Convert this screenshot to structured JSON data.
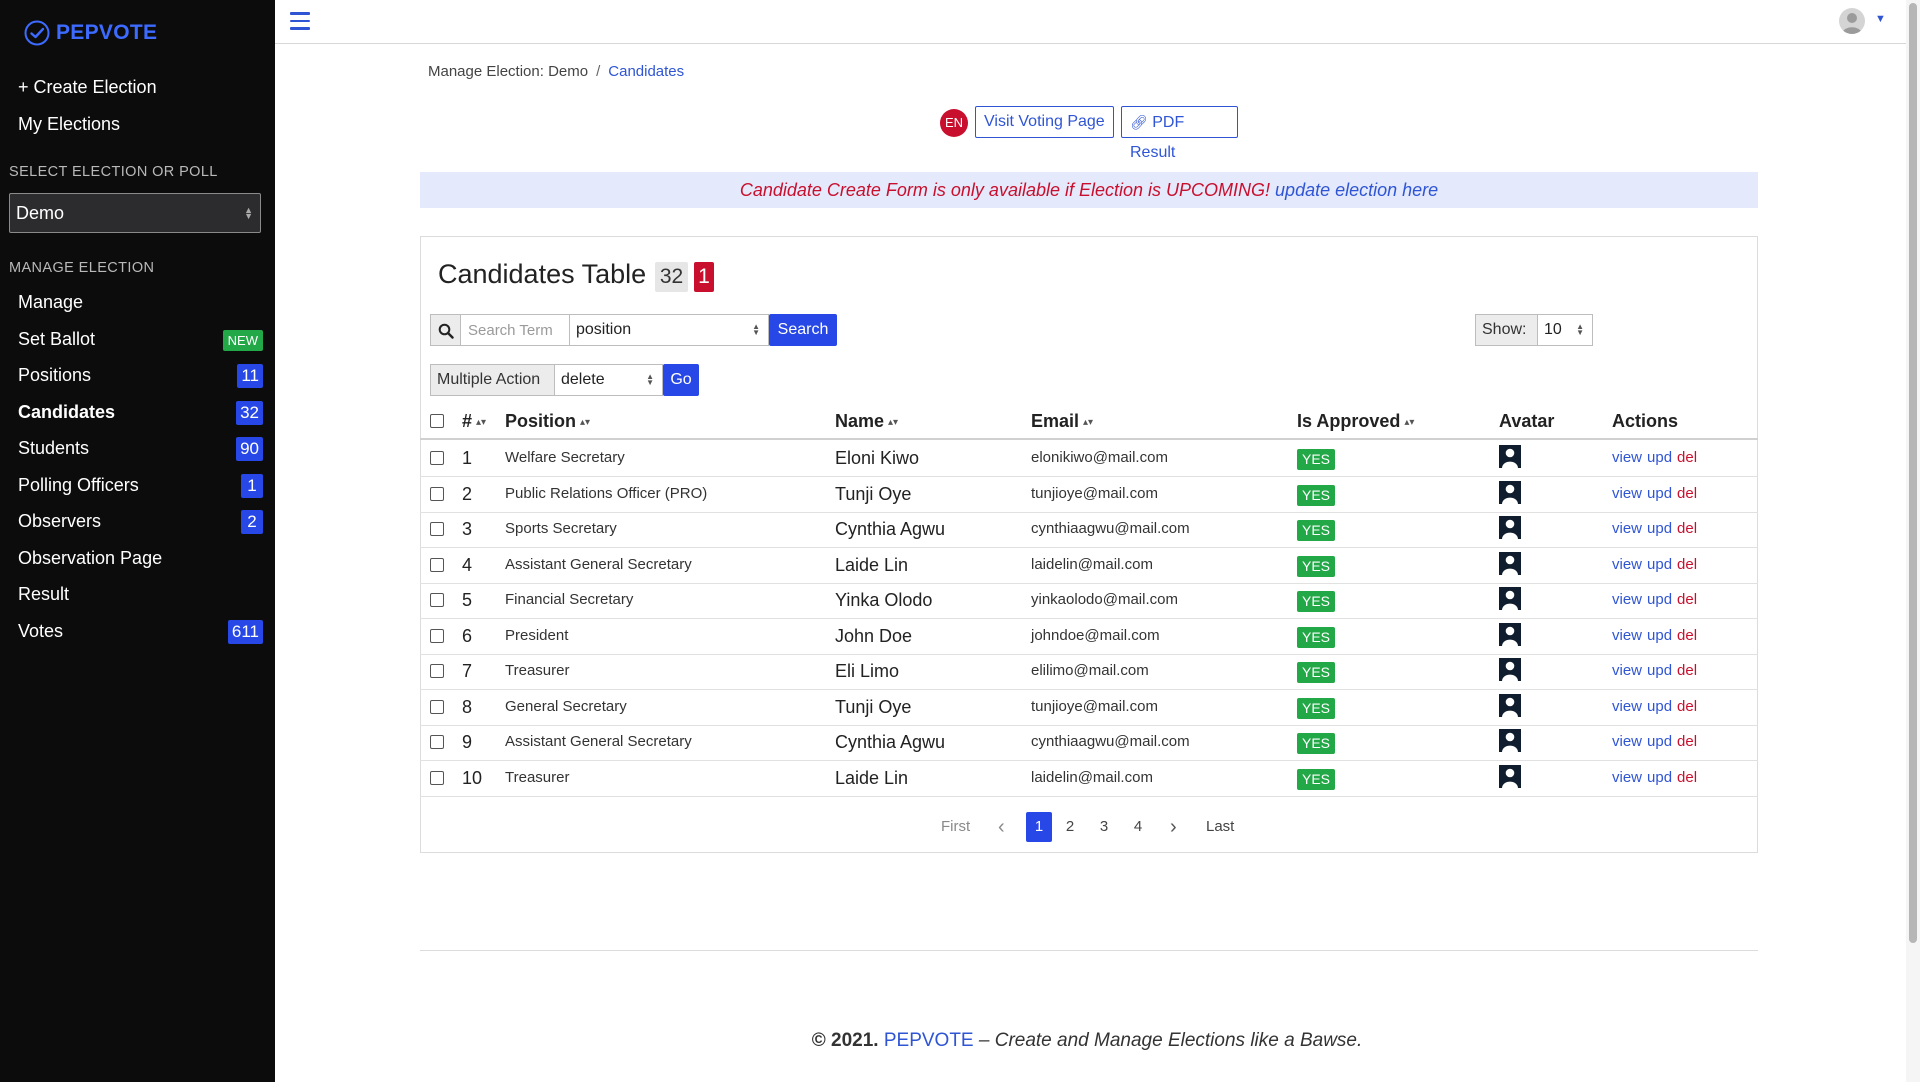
{
  "brand": {
    "name": "PEPVOTE"
  },
  "sidebar": {
    "create_election": "+ Create Election",
    "my_elections": "My Elections",
    "select_heading": "SELECT ELECTION OR POLL",
    "selected_election": "Demo",
    "manage_heading": "MANAGE ELECTION",
    "items": [
      {
        "label": "Manage",
        "badge": ""
      },
      {
        "label": "Set Ballot",
        "badge": "NEW"
      },
      {
        "label": "Positions",
        "badge": "11"
      },
      {
        "label": "Candidates",
        "badge": "32"
      },
      {
        "label": "Students",
        "badge": "90"
      },
      {
        "label": "Polling Officers",
        "badge": "1"
      },
      {
        "label": "Observers",
        "badge": "2"
      },
      {
        "label": "Observation Page",
        "badge": ""
      },
      {
        "label": "Result",
        "badge": ""
      },
      {
        "label": "Votes",
        "badge": "611"
      }
    ]
  },
  "breadcrumb": {
    "parent": "Manage Election: Demo",
    "separator": "/",
    "current": "Candidates"
  },
  "actions": {
    "lang": "EN",
    "visit_voting": "Visit Voting Page",
    "pdf_result": "PDF Result"
  },
  "notice": {
    "warning": "Candidate Create Form is only available if Election is UPCOMING!",
    "link": "update election here"
  },
  "table": {
    "title": "Candidates Table",
    "count_total": "32",
    "count_flag": "1",
    "search_placeholder": "Search Term",
    "search_field": "position",
    "search_button": "Search",
    "show_label": "Show:",
    "show_value": "10",
    "multi_action_label": "Multiple Action",
    "multi_action_value": "delete",
    "go_button": "Go",
    "columns": {
      "num": "#",
      "position": "Position",
      "name": "Name",
      "email": "Email",
      "approved": "Is Approved",
      "avatar": "Avatar",
      "actions": "Actions"
    },
    "action_labels": {
      "view": "view",
      "upd": "upd",
      "del": "del"
    },
    "rows": [
      {
        "num": "1",
        "position": "Welfare Secretary",
        "name": "Eloni Kiwo",
        "email": "elonikiwo@mail.com",
        "approved": "YES"
      },
      {
        "num": "2",
        "position": "Public Relations Officer (PRO)",
        "name": "Tunji Oye",
        "email": "tunjioye@mail.com",
        "approved": "YES"
      },
      {
        "num": "3",
        "position": "Sports Secretary",
        "name": "Cynthia Agwu",
        "email": "cynthiaagwu@mail.com",
        "approved": "YES"
      },
      {
        "num": "4",
        "position": "Assistant General Secretary",
        "name": "Laide Lin",
        "email": "laidelin@mail.com",
        "approved": "YES"
      },
      {
        "num": "5",
        "position": "Financial Secretary",
        "name": "Yinka Olodo",
        "email": "yinkaolodo@mail.com",
        "approved": "YES"
      },
      {
        "num": "6",
        "position": "President",
        "name": "John Doe",
        "email": "johndoe@mail.com",
        "approved": "YES"
      },
      {
        "num": "7",
        "position": "Treasurer",
        "name": "Eli Limo",
        "email": "elilimo@mail.com",
        "approved": "YES"
      },
      {
        "num": "8",
        "position": "General Secretary",
        "name": "Tunji Oye",
        "email": "tunjioye@mail.com",
        "approved": "YES"
      },
      {
        "num": "9",
        "position": "Assistant General Secretary",
        "name": "Cynthia Agwu",
        "email": "cynthiaagwu@mail.com",
        "approved": "YES"
      },
      {
        "num": "10",
        "position": "Treasurer",
        "name": "Laide Lin",
        "email": "laidelin@mail.com",
        "approved": "YES"
      }
    ]
  },
  "pagination": {
    "first": "First",
    "pages": [
      "1",
      "2",
      "3",
      "4"
    ],
    "current": "1",
    "last": "Last"
  },
  "footer": {
    "copyright": "© 2021.",
    "brand": "PEPVOTE",
    "tagline": "– Create and Manage Elections like a Bawse."
  },
  "colors": {
    "accent": "#2748e6",
    "danger": "#c8102e",
    "success": "#23a848",
    "sidebar_bg": "#0c0c0d"
  }
}
